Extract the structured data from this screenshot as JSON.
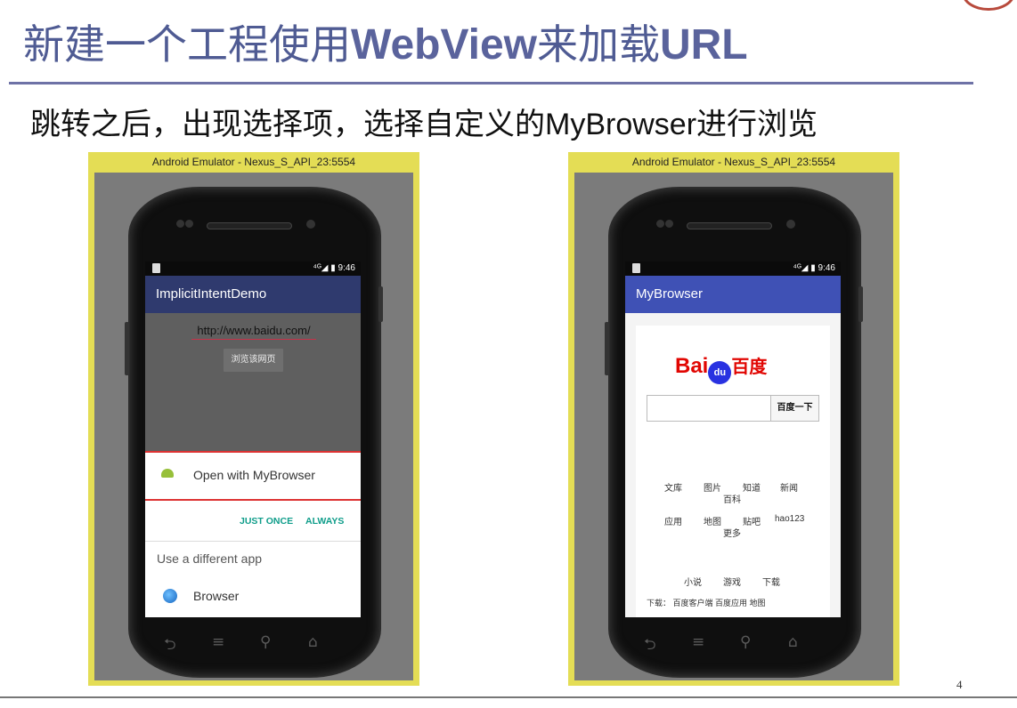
{
  "slide": {
    "title_cn_1": "新建一个工程使用",
    "title_en_1": "WebView",
    "title_cn_2": "来加载",
    "title_en_2": "URL",
    "subtitle_1": "跳转之后，出现选择项，选择自定义的",
    "subtitle_en": "MyBrowser",
    "subtitle_2": "进行浏览",
    "page_number": "4"
  },
  "left_emulator": {
    "window_title": "Android Emulator - Nexus_S_API_23:5554",
    "status_time": "⁴ᴳ◢ ▮ 9:46",
    "app_title": "ImplicitIntentDemo",
    "app_bar_color": "#2f3a6e",
    "url_value": "http://www.baidu.com/",
    "browse_button": "浏览该网页",
    "chooser": {
      "open_with": "Open with MyBrowser",
      "just_once": "JUST ONCE",
      "always": "ALWAYS",
      "different_app": "Use a different app",
      "browser": "Browser"
    },
    "nav_icons": [
      "back-icon",
      "menu-icon",
      "search-icon",
      "home-icon"
    ]
  },
  "right_emulator": {
    "window_title": "Android Emulator - Nexus_S_API_23:5554",
    "status_time": "⁴ᴳ◢ ▮ 9:46",
    "app_title": "MyBrowser",
    "app_bar_color": "#3f51b5",
    "baidu": {
      "logo_bai": "Bai",
      "logo_du": "du",
      "logo_cn": "百度",
      "search_button": "百度一下",
      "links_row1": [
        "文库",
        "图片",
        "知道",
        "新闻"
      ],
      "links_row1_extra": "百科",
      "links_row2": [
        "应用",
        "地图",
        "贴吧",
        "hao123"
      ],
      "links_row2_extra": "更多",
      "links_row3": [
        "小说",
        "游戏",
        "下载"
      ],
      "download_line": "下载：  百度客户端   百度应用   地图"
    }
  }
}
